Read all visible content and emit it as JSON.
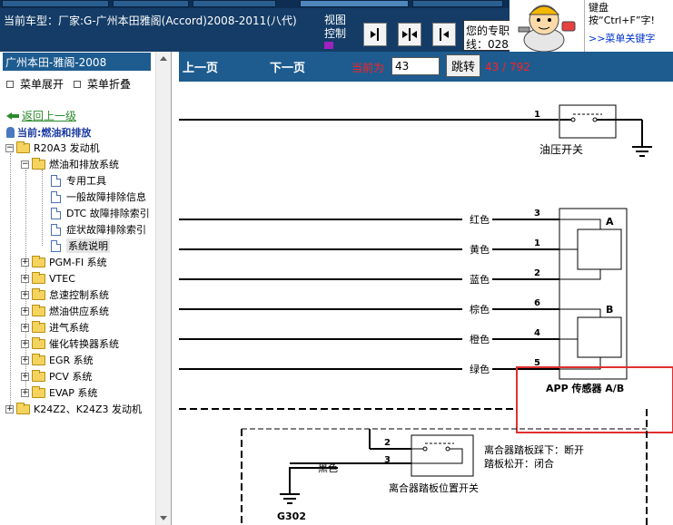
{
  "header": {
    "car_title": "当前车型：厂家:G-广州本田雅阁(Accord)2008-2011(八代)",
    "view_label": "视图控制",
    "message_text": "您的专职\n线：028",
    "hint_text": "键盘按“Ctrl+F”字!",
    "hint_link": ">>菜单关键字"
  },
  "view_buttons": [
    {
      "name": "view-right-icon"
    },
    {
      "name": "view-split-icon"
    },
    {
      "name": "view-left-icon"
    }
  ],
  "sidebar": {
    "title": "广州本田-雅阁-2008",
    "expand_label": "菜单展开",
    "collapse_label": "菜单折叠",
    "back_label": "返回上一级",
    "current_label": "当前:燃油和排放",
    "tree": [
      {
        "label": "R20A3 发动机"
      },
      {
        "label": "燃油和排放系统"
      },
      {
        "label": "专用工具"
      },
      {
        "label": "一般故障排除信息"
      },
      {
        "label": "DTC 故障排除索引"
      },
      {
        "label": "症状故障排除索引"
      },
      {
        "label": "系统说明"
      },
      {
        "label": "PGM-FI 系统"
      },
      {
        "label": "VTEC"
      },
      {
        "label": "怠速控制系统"
      },
      {
        "label": "燃油供应系统"
      },
      {
        "label": "进气系统"
      },
      {
        "label": "催化转换器系统"
      },
      {
        "label": "EGR 系统"
      },
      {
        "label": "PCV 系统"
      },
      {
        "label": "EVAP 系统"
      },
      {
        "label": "K24Z2、K24Z3 发动机"
      }
    ]
  },
  "nav": {
    "prev_label": "上一页",
    "next_label": "下一页",
    "current_label": "当前为",
    "page_value": "43",
    "jump_label": "跳转",
    "page_info": "43 / 792"
  },
  "diagram": {
    "oil_switch": {
      "pin": "1",
      "label": "油压开关"
    },
    "app_sensor": {
      "label": "APP 传感器 A/B",
      "section_a": "A",
      "section_b": "B",
      "wires": [
        {
          "color": "红色",
          "pin": "3"
        },
        {
          "color": "黄色",
          "pin": "1"
        },
        {
          "color": "蓝色",
          "pin": "2"
        },
        {
          "color": "棕色",
          "pin": "6"
        },
        {
          "color": "橙色",
          "pin": "4"
        },
        {
          "color": "绿色",
          "pin": "5"
        }
      ]
    },
    "clutch_switch": {
      "pin_top": "2",
      "pin_bottom": "3",
      "wire_color": "黑色",
      "label": "离合器踏板位置开关",
      "note_line1": "离合器踏板踩下：断开",
      "note_line2": "踏板松开：闭合",
      "ground": "G302"
    },
    "highlight_color": "#e03030"
  }
}
